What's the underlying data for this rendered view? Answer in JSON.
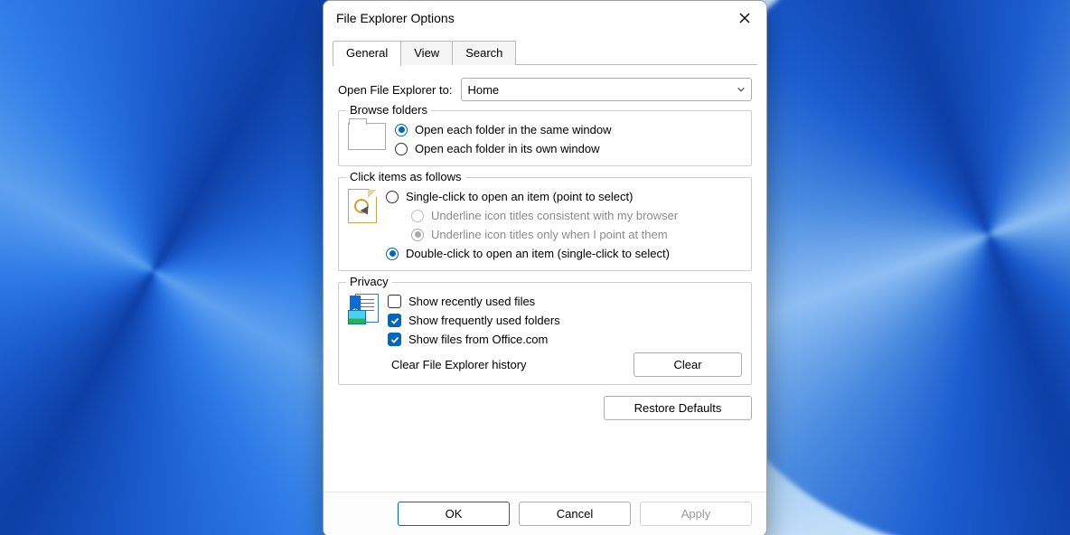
{
  "dialog": {
    "title": "File Explorer Options"
  },
  "tabs": {
    "general": "General",
    "view": "View",
    "search": "Search",
    "active": "general"
  },
  "open_to": {
    "label": "Open File Explorer to:",
    "value": "Home"
  },
  "browse_folders": {
    "legend": "Browse folders",
    "same_window": "Open each folder in the same window",
    "own_window": "Open each folder in its own window",
    "selected": "same_window"
  },
  "click_items": {
    "legend": "Click items as follows",
    "single": "Single-click to open an item (point to select)",
    "underline_browser": "Underline icon titles consistent with my browser",
    "underline_point": "Underline icon titles only when I point at them",
    "double": "Double-click to open an item (single-click to select)",
    "selected": "double",
    "sub_selected": "underline_point"
  },
  "privacy": {
    "legend": "Privacy",
    "recent_files": {
      "label": "Show recently used files",
      "checked": false
    },
    "frequent_folders": {
      "label": "Show frequently used folders",
      "checked": true
    },
    "office_files": {
      "label": "Show files from Office.com",
      "checked": true
    },
    "clear_label": "Clear File Explorer history",
    "clear_button": "Clear"
  },
  "restore_defaults": "Restore Defaults",
  "buttons": {
    "ok": "OK",
    "cancel": "Cancel",
    "apply": "Apply"
  }
}
